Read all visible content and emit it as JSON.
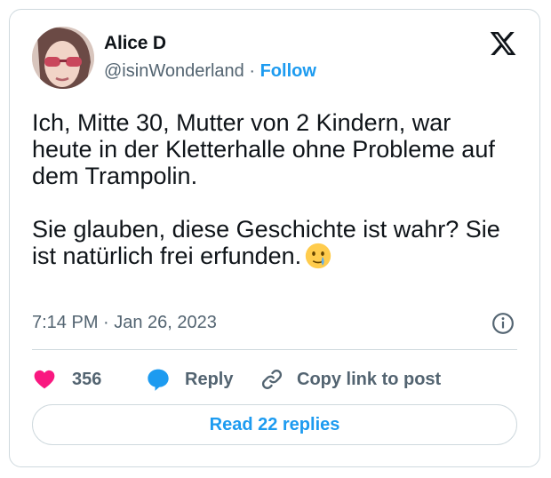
{
  "author": {
    "name": "Alice D",
    "handle": "@isinWonderland",
    "separator": "·",
    "follow_label": "Follow"
  },
  "tweet": {
    "line_1": "Ich, Mitte 30, Mutter von 2 Kindern, war heute in der Kletterhalle ohne Probleme auf dem Trampolin.",
    "line_2": "Sie glauben, diese Geschichte ist wahr? Sie ist natürlich frei erfunden.",
    "emoji": "face-holding-back-tears",
    "time": "7:14 PM · Jan 26, 2023"
  },
  "actions": {
    "like_count": "356",
    "reply_label": "Reply",
    "copy_label": "Copy link to post"
  },
  "read_replies_label": "Read 22 replies",
  "icons": {
    "brand": "x-logo-icon",
    "like": "heart-icon",
    "reply": "speech-bubble-icon",
    "copy": "link-icon",
    "info": "info-icon"
  },
  "colors": {
    "accent": "#1d9bf0",
    "like": "#f91880",
    "text": "#0f1419",
    "muted": "#536471",
    "border": "#cfd9de"
  }
}
